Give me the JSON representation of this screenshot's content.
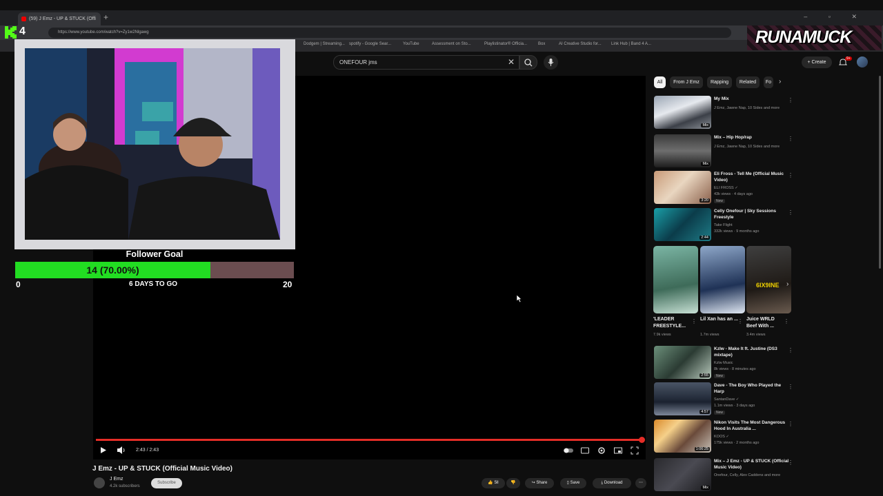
{
  "browser": {
    "tab_title": "(59) J Emz - UP & STUCK (Offi",
    "new_tab": "+",
    "window_controls": "– ▫ ✕",
    "url": "https://www.youtube.com/watch?v=Zy1w2Nlgawg",
    "bookmarks": [
      "Dodgem | Streaming...",
      "spotify - Google Sear...",
      "YouTube",
      "Assessment on Sto...",
      "Playlistinator® Officia...",
      "Box",
      "AI Creative Studio for...",
      "Link Hub | Band 4 A..."
    ]
  },
  "youtube": {
    "search_value": "ONEFOUR jms",
    "create_label": "Create",
    "notification_count": "9+"
  },
  "player": {
    "time": "2:43 / 2:43",
    "progress": 1.0
  },
  "video": {
    "title": "J Emz - UP & STUCK (Official Music Video)",
    "channel": "J Emz",
    "subscribers": "4.2k subscribers",
    "subscribe_label": "Subscribe",
    "likes": "5ll",
    "share_label": "Share",
    "save_label": "Save",
    "download_label": "Download"
  },
  "chips": [
    "All",
    "From J Emz",
    "Rapping",
    "Related",
    "Fo"
  ],
  "recommendations": [
    {
      "title": "My Mix",
      "meta1": "J Emz, Jawne Nap, 10 Sides and more",
      "meta2": "",
      "badge": "Mix",
      "duration": "",
      "new": false
    },
    {
      "title": "Mix – Hip Hop/rap",
      "meta1": "J Emz, Jawne Nap, 10 Sides and more",
      "meta2": "",
      "badge": "Mix",
      "duration": "",
      "new": false
    },
    {
      "title": "Eli Fross - Tell Me (Official Music Video)",
      "meta1": "ELI FROSS ✓",
      "meta2": "43k views · 4 days ago",
      "badge": "",
      "duration": "3:20",
      "new": true
    },
    {
      "title": "Celly Onefour | Sky Sessions Freestyle",
      "meta1": "Take Flight",
      "meta2": "332k views · 9 months ago",
      "badge": "",
      "duration": "2:44",
      "new": false
    },
    {
      "title": "Kzlw - Make It ft. Justine (DS3 mixtape)",
      "meta1": "Kzlw Music",
      "meta2": "8k views · 8 minutes ago",
      "badge": "",
      "duration": "2:55",
      "new": true
    },
    {
      "title": "Dave - The Boy Who Played the Harp",
      "meta1": "SantanDave ✓",
      "meta2": "1.1m views · 3 days ago",
      "badge": "",
      "duration": "4:57",
      "new": true
    },
    {
      "title": "Nikon Visits The Most Dangerous Hood In Australia ...",
      "meta1": "KOOS ✓",
      "meta2": "175k views · 2 months ago",
      "badge": "",
      "duration": "1:06:25",
      "new": false
    },
    {
      "title": "Mix – J Emz - UP & STUCK (Official Music Video)",
      "meta1": "Onefour, Celly, Alex Caddens and more",
      "meta2": "",
      "badge": "Mix",
      "duration": "",
      "new": false
    }
  ],
  "shorts": [
    {
      "title": "'LEADER FREESTYLE...",
      "views": "7.9k views",
      "caption": ""
    },
    {
      "title": "Lil Xan has an ...",
      "views": "1.7m views",
      "caption": ""
    },
    {
      "title": "Juice WRLD Beef With ...",
      "views": "3.4m views",
      "caption": "6IX9INE"
    }
  ],
  "overlay": {
    "kick_number": "4",
    "logo_text": "RUNAMUCK",
    "goal_title": "Follower Goal",
    "goal_value_text": "14 (70.00%)",
    "goal_fraction": 0.7,
    "goal_min": "0",
    "goal_max": "20",
    "goal_days": "6 DAYS TO GO"
  },
  "colors": {
    "youtube_red": "#e52d27",
    "goal_green": "#22dd22",
    "kick_green": "#53fc18"
  }
}
